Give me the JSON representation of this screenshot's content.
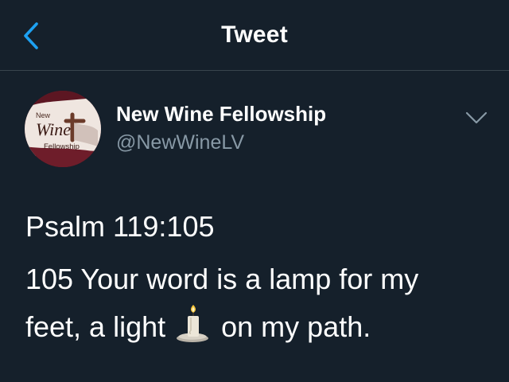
{
  "header": {
    "title": "Tweet",
    "back_icon": "chevron-left-icon",
    "accent_color": "#1da1f2"
  },
  "author": {
    "display_name": "New Wine Fellowship",
    "handle": "@NewWineLV",
    "avatar_text_top": "New",
    "avatar_text_main": "Wine",
    "avatar_text_bottom": "Fellowship",
    "more_icon": "chevron-down-icon"
  },
  "tweet": {
    "line1": "Psalm 119:105",
    "line2": "105 Your word is a lamp for my",
    "line3_before": "feet, a light",
    "line3_after": "on my path.",
    "emoji_icon": "candle-icon"
  },
  "colors": {
    "background": "#15202b",
    "divider": "#38444d",
    "secondary_text": "#8899a6"
  }
}
